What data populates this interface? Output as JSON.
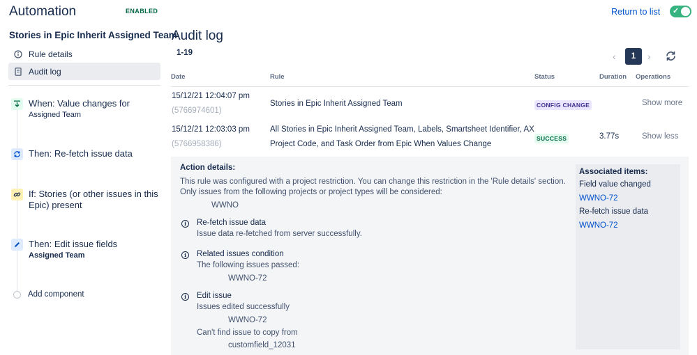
{
  "header": {
    "app_title": "Automation",
    "status_badge": "ENABLED",
    "return_link": "Return to list",
    "toggle_on": true
  },
  "sidebar": {
    "rule_name": "Stories in Epic Inherit Assigned Team",
    "nav": [
      {
        "label": "Rule details",
        "icon": "info-icon",
        "active": false
      },
      {
        "label": "Audit log",
        "icon": "document-icon",
        "active": true
      }
    ],
    "components": [
      {
        "title": "When: Value changes for",
        "subtitle": "Assigned Team",
        "icon": "trigger-icon",
        "color": "#36b37e"
      },
      {
        "title": "Then: Re-fetch issue data",
        "subtitle": "",
        "icon": "refresh-icon",
        "color": "#0065ff"
      },
      {
        "title": "If: Stories (or other issues in this Epic) present",
        "subtitle": "",
        "icon": "link-icon",
        "color": "#ffab00"
      },
      {
        "title": "Then: Edit issue fields",
        "subtitle": "Assigned Team",
        "icon": "pencil-icon",
        "color": "#0065ff"
      }
    ],
    "add_component": "Add component"
  },
  "main": {
    "title": "Audit log",
    "range": "1-19",
    "pagination": {
      "current": "1"
    },
    "columns": [
      "Date",
      "Rule",
      "Status",
      "Duration",
      "Operations"
    ],
    "rows": [
      {
        "date": "15/12/21 12:04:07 pm",
        "id": "(5766974601)",
        "rule": "Stories in Epic Inherit Assigned Team",
        "rule_line2": "",
        "status": "CONFIG CHANGE",
        "duration": "",
        "operation": "Show more"
      },
      {
        "date": "15/12/21 12:03:03 pm",
        "id": "(5766958386)",
        "rule": "All Stories in Epic Inherit Assigned Team, Labels, Smartsheet Identifier, AX",
        "rule_line2": "Project Code, and Task Order from Epic When Values Change",
        "status": "SUCCESS",
        "duration": "3.77s",
        "operation": "Show less"
      }
    ],
    "details": {
      "heading": "Action details:",
      "restriction_line1": "This rule was configured with a project restriction. You can change this restriction in the 'Rule details' section.",
      "restriction_line2": "Only issues from the following projects or project types will be considered:",
      "project": "WWNO",
      "actions": [
        {
          "title": "Re-fetch issue data",
          "lines": [
            "Issue data re-fetched from server successfully."
          ]
        },
        {
          "title": "Related issues condition",
          "lines": [
            "The following issues passed:",
            "WWNO-72"
          ]
        },
        {
          "title": "Edit issue",
          "lines": [
            "Issues edited successfully",
            "WWNO-72",
            "Can't find issue to copy from",
            "customfield_12031"
          ]
        }
      ]
    },
    "associated": {
      "heading": "Associated items:",
      "groups": [
        {
          "label": "Field value changed",
          "link": "WWNO-72"
        },
        {
          "label": "Re-fetch issue data",
          "link": "WWNO-72"
        }
      ]
    }
  },
  "colors": {
    "link": "#0052cc",
    "success": "#006644",
    "config": "#403294",
    "pagination_active": "#253858",
    "toggle": "#36b37e"
  }
}
